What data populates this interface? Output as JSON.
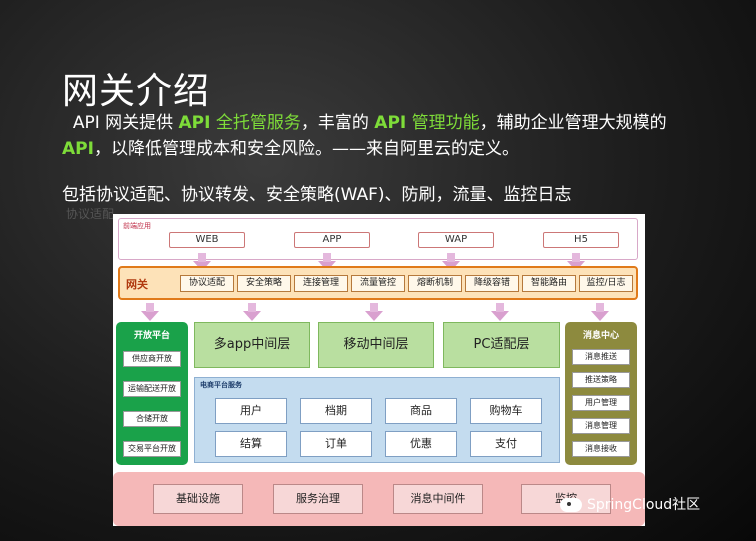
{
  "slide": {
    "title": "网关介绍",
    "desc": {
      "p1": "API 网关提供 ",
      "h1": "API",
      "p2": " 全托管服务",
      "p3": "，丰富的 ",
      "h2": "API",
      "p4": " 管理功能",
      "p5": "，辅助企业管理大规模的 ",
      "h3": "API",
      "p6": "，以降低管理成本和安全风险。——来自阿里云的定义。"
    },
    "subtitle": "包括协议适配、协议转发、安全策略(WAF)、防刷，流量、监控日志",
    "ghost_text": "协议适配"
  },
  "diagram": {
    "frontend": {
      "label": "前端应用",
      "items": [
        "WEB",
        "APP",
        "WAP",
        "H5"
      ]
    },
    "gateway": {
      "label": "网关",
      "items": [
        "协议适配",
        "安全策略",
        "连接管理",
        "流量管控",
        "熔断机制",
        "降级容错",
        "智能路由",
        "监控/日志"
      ]
    },
    "open_platform": {
      "title": "开放平台",
      "items": [
        "供应商开放",
        "运输配送开放",
        "合储开放",
        "交易平台开放"
      ]
    },
    "middle_layers": [
      "多app中间层",
      "移动中间层",
      "PC适配层"
    ],
    "ecommerce": {
      "label": "电商平台服务",
      "items": [
        "用户",
        "档期",
        "商品",
        "购物车",
        "结算",
        "订单",
        "优惠",
        "支付"
      ]
    },
    "message_center": {
      "title": "消息中心",
      "items": [
        "消息推送",
        "推送策略",
        "用户管理",
        "消息管理",
        "消息接收"
      ]
    },
    "infrastructure": [
      "基础设施",
      "服务治理",
      "消息中间件",
      "监控"
    ]
  },
  "watermark": "SpringCloud社区",
  "colors": {
    "highlight": "#7edc39",
    "gateway_border": "#e07a1a",
    "open_platform": "#1aa24a",
    "message_center": "#8d8a3e",
    "infrastructure": "#f5b8b8"
  }
}
